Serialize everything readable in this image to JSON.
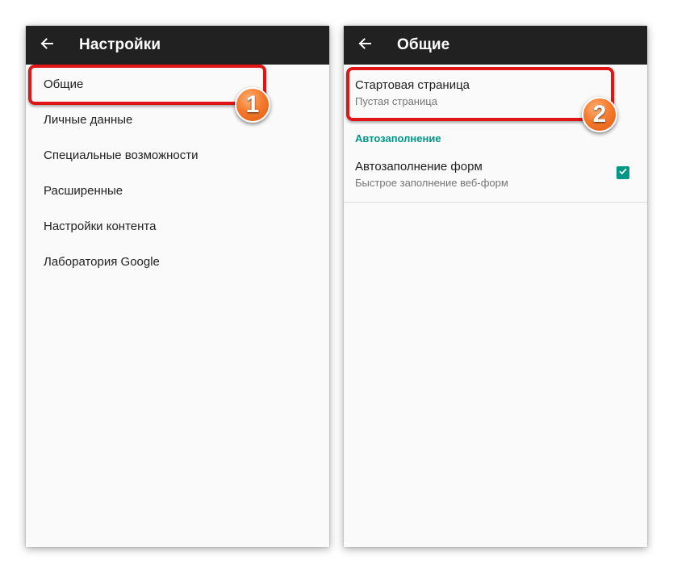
{
  "left_screen": {
    "title": "Настройки",
    "menu": [
      {
        "label": "Общие"
      },
      {
        "label": "Личные данные"
      },
      {
        "label": "Специальные возможности"
      },
      {
        "label": "Расширенные"
      },
      {
        "label": "Настройки контента"
      },
      {
        "label": "Лаборатория Google"
      }
    ]
  },
  "right_screen": {
    "title": "Общие",
    "start_page": {
      "title": "Стартовая страница",
      "summary": "Пустая страница"
    },
    "section_header": "Автозаполнение",
    "autofill": {
      "title": "Автозаполнение форм",
      "summary": "Быстрое заполнение веб-форм",
      "checked": true
    }
  },
  "annotations": {
    "step1": "1",
    "step2": "2"
  },
  "colors": {
    "appbar": "#212121",
    "accent": "#009688",
    "highlight": "#e01515",
    "badge": "#f57b2d"
  },
  "icons": {
    "back": "arrow-left-icon",
    "check": "checkmark-icon"
  }
}
